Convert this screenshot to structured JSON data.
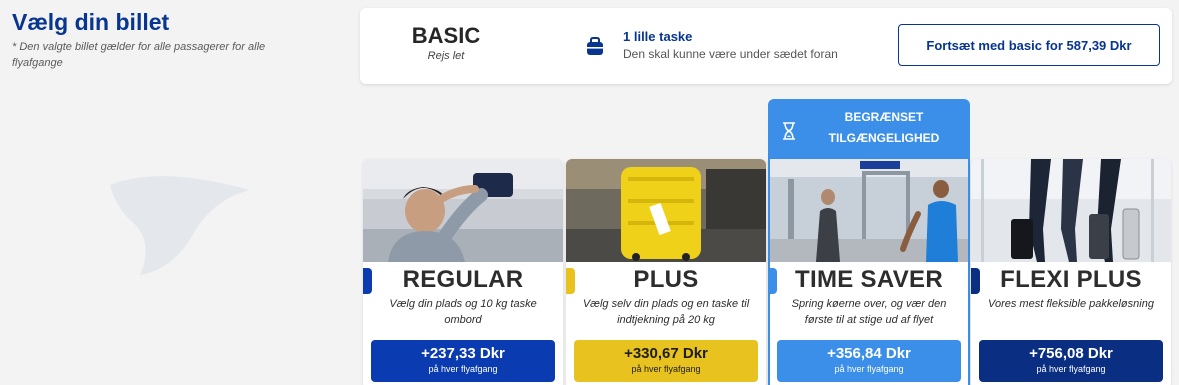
{
  "header": {
    "title": "Vælg din billet",
    "note": "* Den valgte billet gælder for alle passagerer for alle flyafgange"
  },
  "basic": {
    "name": "BASIC",
    "subtitle": "Rejs let",
    "bag_title": "1 lille taske",
    "bag_subtitle": "Den skal kunne være under sædet foran",
    "continue_label": "Fortsæt med basic for 587,39 Dkr"
  },
  "banner": {
    "line1": "BEGRÆNSET",
    "line2": "TILGÆNGELIGHED"
  },
  "fares": [
    {
      "name": "REGULAR",
      "description": "Vælg din plads og 10 kg taske ombord",
      "price": "+237,33 Dkr",
      "per": "på hver flyafgang",
      "color": "#0a3bb0"
    },
    {
      "name": "PLUS",
      "description": "Vælg selv din plads og en taske til indtjekning på 20 kg",
      "price": "+330,67 Dkr",
      "per": "på hver flyafgang",
      "color": "#e8c21f"
    },
    {
      "name": "TIME SAVER",
      "description": "Spring køerne over, og vær den første til at stige ud af flyet",
      "price": "+356,84 Dkr",
      "per": "på hver flyafgang",
      "color": "#3b8fe8"
    },
    {
      "name": "FLEXI PLUS",
      "description": "Vores mest fleksible pakkeløsning",
      "price": "+756,08 Dkr",
      "per": "på hver flyafgang",
      "color": "#0a2e82"
    }
  ],
  "icons": {
    "bag": "small-bag-icon",
    "hourglass": "hourglass-icon",
    "logo": "harp-logo-watermark"
  },
  "colors": {
    "brand_blue": "#073590",
    "accent_blue": "#3b8fe8",
    "accent_yellow": "#e8c21f"
  }
}
